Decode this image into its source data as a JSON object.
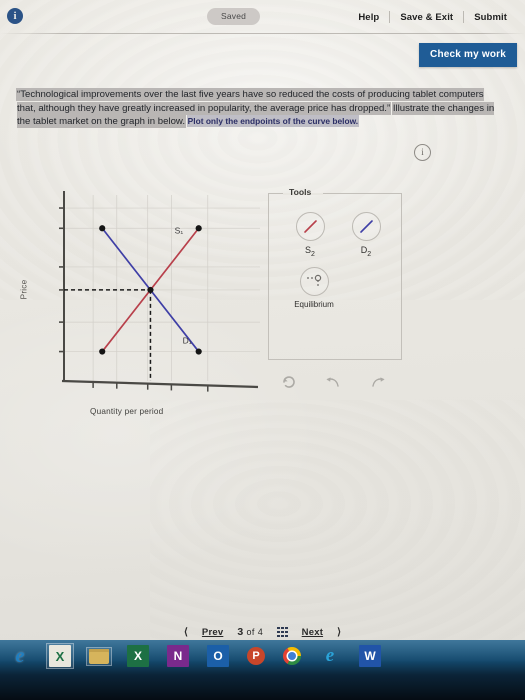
{
  "topbar": {
    "info_icon": "info-icon",
    "saved_label": "Saved",
    "actions": [
      "Help",
      "Save & Exit",
      "Submit"
    ],
    "check_button": "Check my work"
  },
  "question": {
    "quoted_text": "“Technological improvements over the last five years have so reduced the costs of producing tablet computers that, although they have greatly increased in popularity, the average price has dropped.”",
    "instruction": "Illustrate the changes in the tablet market on the graph in below.",
    "hint": "Plot only the endpoints of the curve below.",
    "info_icon": "info-icon"
  },
  "chart_data": {
    "type": "line",
    "title": "",
    "xlabel": "Quantity per period",
    "ylabel": "Price",
    "xlim": [
      0,
      10
    ],
    "ylim": [
      0,
      10
    ],
    "grid": true,
    "series": [
      {
        "name": "S1",
        "label": "S₁",
        "color": "#b8404b",
        "points": [
          [
            2.1,
            1.6
          ],
          [
            7.4,
            8.3
          ]
        ],
        "endpoints_marked": true
      },
      {
        "name": "D1",
        "label": "D₁",
        "color": "#3f3fa6",
        "points": [
          [
            2.1,
            8.3
          ],
          [
            7.4,
            1.6
          ]
        ],
        "endpoints_marked": true
      }
    ],
    "equilibrium": {
      "label": "",
      "x": 4.75,
      "y": 4.95,
      "dashed_guides": true
    },
    "x_ticks": [
      1.6,
      2.9,
      4.6,
      5.9,
      7.9
    ],
    "y_ticks": [
      1.6,
      3.2,
      4.95,
      6.2,
      8.3,
      9.4
    ]
  },
  "tools": {
    "legend": "Tools",
    "items": [
      {
        "id": "s2",
        "label": "S",
        "sub": "2",
        "icon": "red-line-icon",
        "color": "#b8404b"
      },
      {
        "id": "d2",
        "label": "D",
        "sub": "2",
        "icon": "blue-line-icon",
        "color": "#3f3fa6"
      },
      {
        "id": "equilibrium",
        "label": "Equilibrium",
        "sub": "",
        "icon": "equilibrium-point-icon",
        "color": "#6f6d69"
      }
    ],
    "actions": [
      {
        "id": "reset",
        "icon": "reset-icon"
      },
      {
        "id": "undo",
        "icon": "undo-arrow-icon"
      },
      {
        "id": "redo",
        "icon": "redo-arrow-icon"
      }
    ]
  },
  "bottom_nav": {
    "prev": "Prev",
    "next": "Next",
    "current_page": "3",
    "of_word": "of",
    "total_pages": "4",
    "grid_icon": "grid-menu-icon"
  },
  "taskbar": {
    "items": [
      {
        "id": "edge",
        "icon": "edge-icon",
        "glyph": "e"
      },
      {
        "id": "excel-green",
        "icon": "excel-icon",
        "glyph": "X"
      },
      {
        "id": "file-explorer",
        "icon": "folder-icon",
        "glyph": ""
      },
      {
        "id": "excel",
        "icon": "excel-icon",
        "glyph": "X"
      },
      {
        "id": "onenote",
        "icon": "onenote-icon",
        "glyph": "N"
      },
      {
        "id": "outlook",
        "icon": "outlook-icon",
        "glyph": "O"
      },
      {
        "id": "powerpoint",
        "icon": "powerpoint-icon",
        "glyph": "P"
      },
      {
        "id": "chrome",
        "icon": "chrome-icon",
        "glyph": ""
      },
      {
        "id": "internet-explorer",
        "icon": "internet-explorer-icon",
        "glyph": "e"
      },
      {
        "id": "word",
        "icon": "word-icon",
        "glyph": "W"
      }
    ]
  },
  "colors": {
    "accent_blue": "#1f5c96",
    "supply_red": "#b8404b",
    "demand_blue": "#3f3fa6",
    "page_bg": "#e9e7e1"
  }
}
